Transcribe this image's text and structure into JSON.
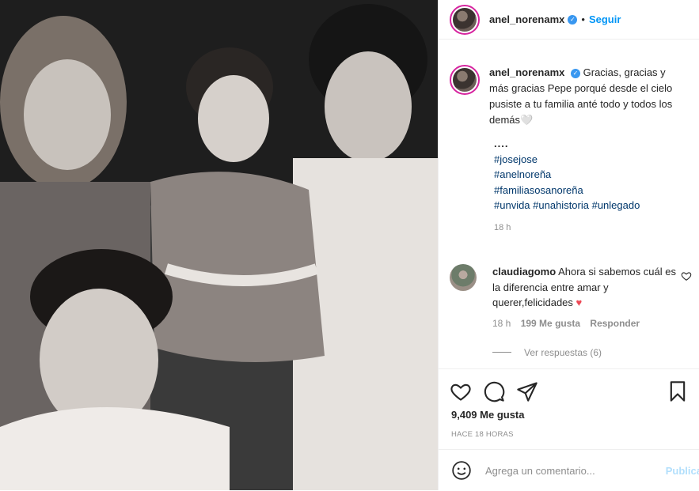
{
  "post": {
    "username": "anel_norenamx",
    "follow_label": "Seguir",
    "separator": "•"
  },
  "caption": {
    "username": "anel_norenamx",
    "text": "Gracias, gracias y más gracias Pepe porqué desde el cielo pusiste a tu familia anté todo y todos los demás🤍",
    "dots": "....",
    "hashtags": [
      "#josejose",
      "#anelnoreña",
      "#familiasosanoreña",
      "#unvida #unahistoria #unlegado"
    ],
    "time": "18 h"
  },
  "comment": {
    "username": "claudiagomo",
    "text": "Ahora si sabemos cuál es la diferencia entre amar y querer,felicidades",
    "emoji": "♥",
    "time": "18 h",
    "likes": "199 Me gusta",
    "reply": "Responder",
    "view_replies": "Ver respuestas (6)"
  },
  "actions": {
    "likes": "9,409 Me gusta",
    "posted_ago": "HACE 18 HORAS"
  },
  "add_comment": {
    "placeholder": "Agrega un comentario...",
    "publish": "Publicar"
  },
  "icons": [
    "heart-icon",
    "comment-icon",
    "share-icon",
    "bookmark-icon",
    "emoji-icon",
    "verified-icon"
  ],
  "colors": {
    "accent": "#0095f6",
    "hashtag": "#00376b",
    "heart": "#ed4956",
    "muted": "#8e8e8e"
  }
}
